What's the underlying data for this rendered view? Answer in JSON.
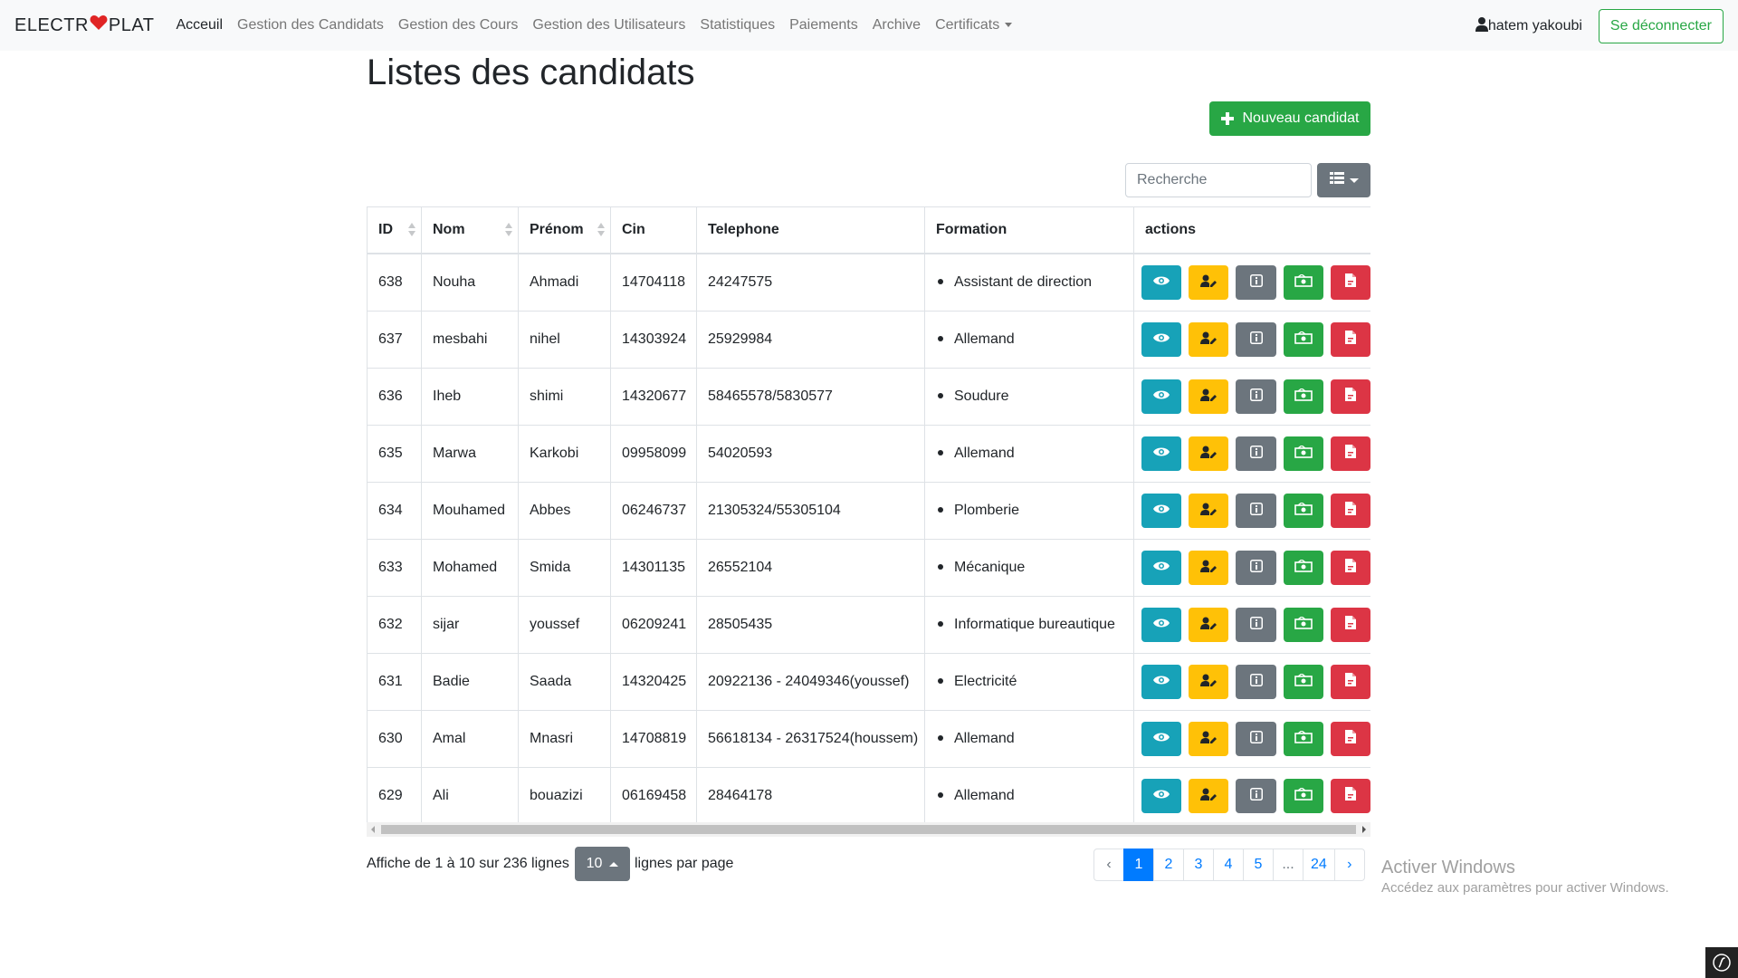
{
  "navbar": {
    "brand_left": "ELECTR",
    "brand_right": "PLAT",
    "links": [
      {
        "label": "Acceuil",
        "active": true
      },
      {
        "label": "Gestion des Candidats"
      },
      {
        "label": "Gestion des Cours"
      },
      {
        "label": "Gestion des Utilisateurs"
      },
      {
        "label": "Statistiques"
      },
      {
        "label": "Paiements"
      },
      {
        "label": "Archive"
      },
      {
        "label": "Certificats",
        "dropdown": true
      }
    ],
    "user_name": "hatem yakoubi",
    "logout_label": "Se déconnecter"
  },
  "page": {
    "title": "Listes des candidats",
    "new_button_label": "Nouveau candidat",
    "search_placeholder": "Recherche"
  },
  "table": {
    "headers": [
      "ID",
      "Nom",
      "Prénom",
      "Cin",
      "Telephone",
      "Formation",
      "actions"
    ],
    "rows": [
      {
        "id": "638",
        "nom": "Nouha",
        "prenom": "Ahmadi",
        "cin": "14704118",
        "tel": "24247575",
        "formation": "Assistant de direction"
      },
      {
        "id": "637",
        "nom": "mesbahi",
        "prenom": "nihel",
        "cin": "14303924",
        "tel": "25929984",
        "formation": "Allemand"
      },
      {
        "id": "636",
        "nom": "Iheb",
        "prenom": "shimi",
        "cin": "14320677",
        "tel": "58465578/5830577",
        "formation": "Soudure"
      },
      {
        "id": "635",
        "nom": "Marwa",
        "prenom": "Karkobi",
        "cin": "09958099",
        "tel": "54020593",
        "formation": "Allemand"
      },
      {
        "id": "634",
        "nom": "Mouhamed",
        "prenom": "Abbes",
        "cin": "06246737",
        "tel": "21305324/55305104",
        "formation": "Plomberie"
      },
      {
        "id": "633",
        "nom": "Mohamed",
        "prenom": "Smida",
        "cin": "14301135",
        "tel": "26552104",
        "formation": "Mécanique"
      },
      {
        "id": "632",
        "nom": "sijar",
        "prenom": "youssef",
        "cin": "06209241",
        "tel": "28505435",
        "formation": "Informatique bureautique"
      },
      {
        "id": "631",
        "nom": "Badie",
        "prenom": "Saada",
        "cin": "14320425",
        "tel": "20922136 - 24049346(youssef)",
        "formation": "Electricité"
      },
      {
        "id": "630",
        "nom": "Amal",
        "prenom": "Mnasri",
        "cin": "14708819",
        "tel": "56618134 - 26317524(houssem)",
        "formation": "Allemand"
      },
      {
        "id": "629",
        "nom": "Ali",
        "prenom": "bouazizi",
        "cin": "06169458",
        "tel": "28464178",
        "formation": "Allemand"
      }
    ],
    "row_actions": [
      "eye-icon",
      "user-edit-icon",
      "info-icon",
      "money-bill-icon",
      "file-pdf-icon"
    ],
    "action_colors": {
      "view": "#17a2b8",
      "edit": "#ffc107",
      "info": "#6c757d",
      "pay": "#28a745",
      "pdf": "#dc3545"
    }
  },
  "pagination": {
    "info": "Affiche de 1 à 10 sur 236 lignes",
    "page_size": "10",
    "per_page_label": "lignes par page",
    "prev": "‹",
    "pages": [
      "1",
      "2",
      "3",
      "4",
      "5",
      "...",
      "24"
    ],
    "active_page": "1",
    "next": "›"
  },
  "watermark": {
    "title": "Activer Windows",
    "subtitle": "Accédez aux paramètres pour activer Windows."
  }
}
